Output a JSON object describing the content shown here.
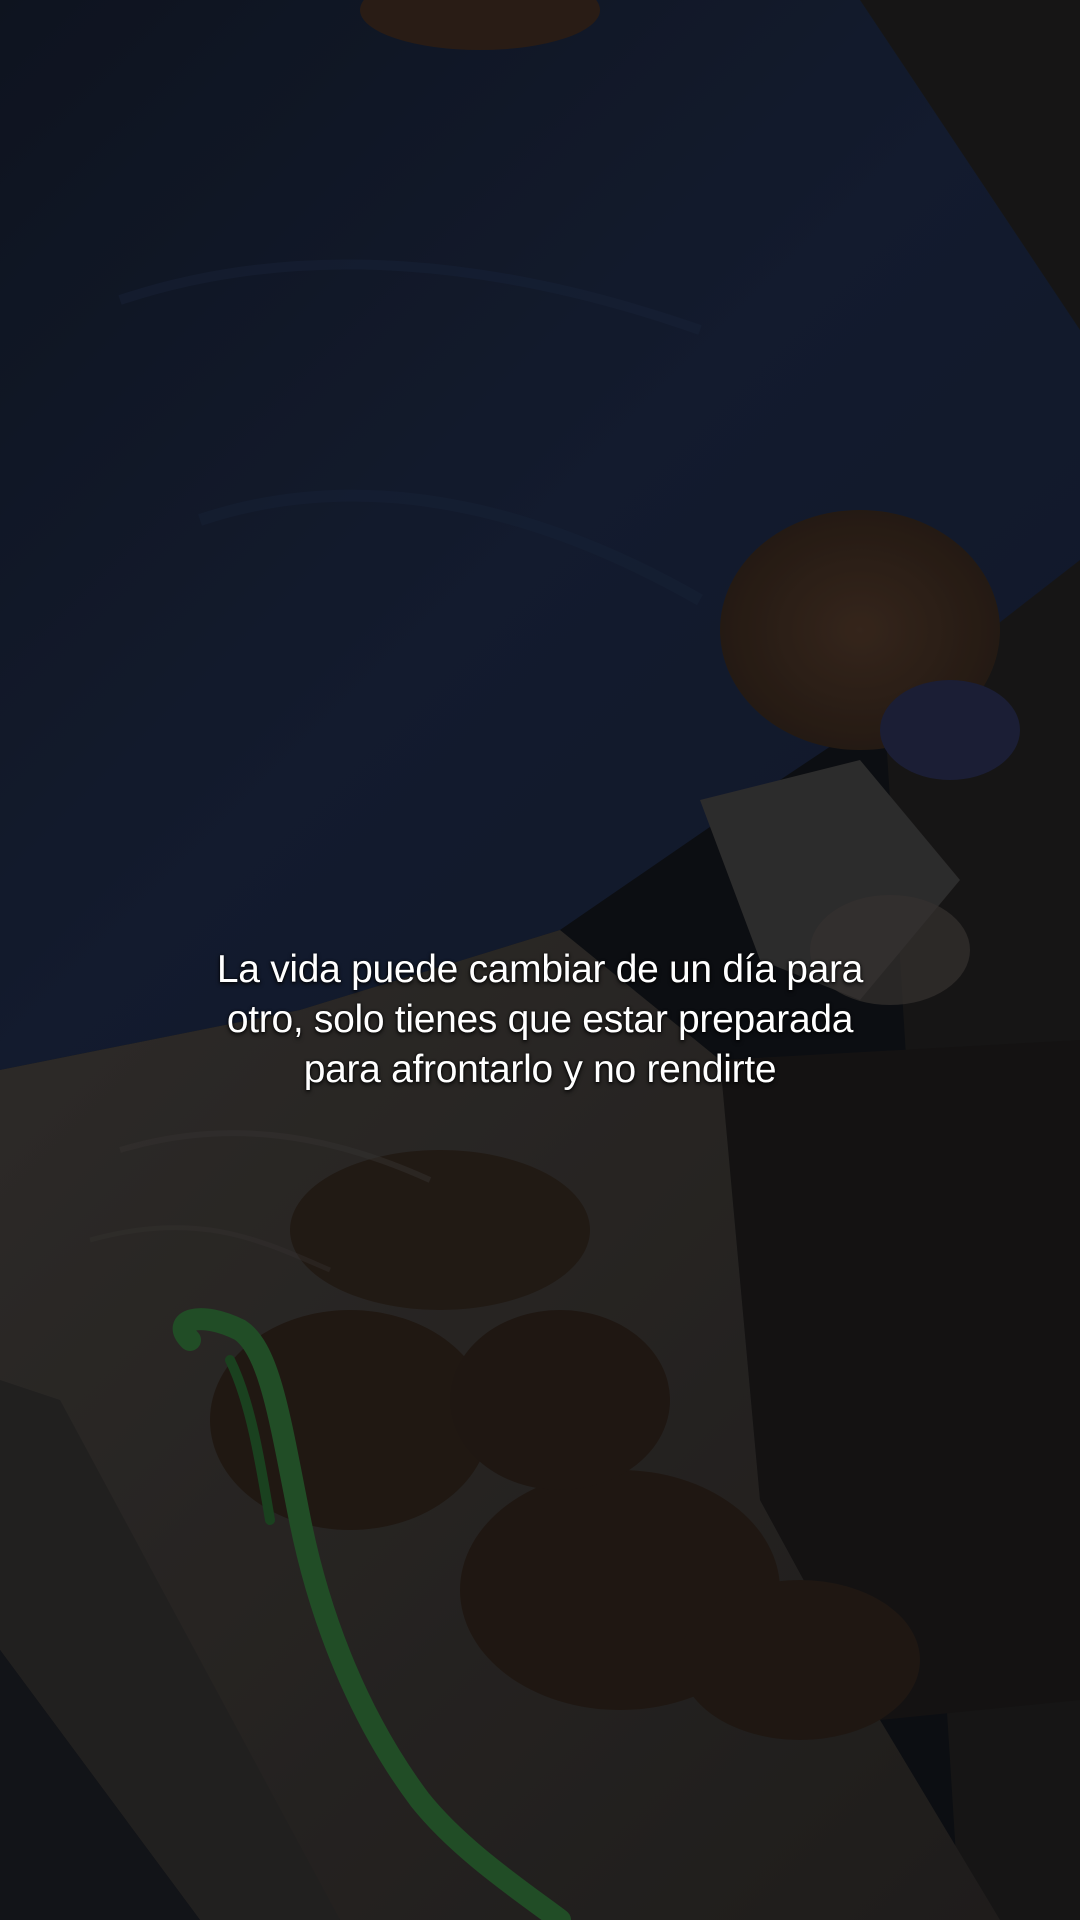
{
  "caption": {
    "line1": "La vida puede cambiar de un día para",
    "line2": "otro, solo tienes que estar preparada",
    "line3": "para afrontarlo y no rendirte"
  },
  "colors": {
    "shirt": "#1a2438",
    "background_dark": "#12151b",
    "blanket_grey": "#3a3532",
    "teddy_brown": "#2f241c",
    "green_strap": "#2f6b35",
    "caption_text": "#ffffff"
  }
}
